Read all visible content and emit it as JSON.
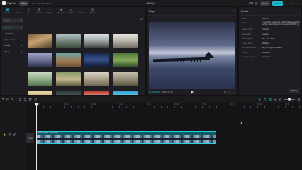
{
  "titlebar": {
    "app_name": "CapCut",
    "menu_label": "Menu",
    "autosave": "Auto saved: 14:38:33",
    "project_title": "0820 (1)",
    "share_label": "Share",
    "export_label": "Export"
  },
  "tools": [
    {
      "label": "Media",
      "icon": "▦"
    },
    {
      "label": "Audio",
      "icon": "♪"
    },
    {
      "label": "Text",
      "icon": "T"
    },
    {
      "label": "Stickers",
      "icon": "✿"
    },
    {
      "label": "Effects",
      "icon": "✦"
    },
    {
      "label": "Transitions",
      "icon": "⧓"
    },
    {
      "label": "Captions",
      "icon": "▭"
    },
    {
      "label": "Filters",
      "icon": "◐"
    },
    {
      "label": "Adjustment",
      "icon": "⊜"
    }
  ],
  "media_side": {
    "import_label": "Import",
    "items": [
      {
        "label": "Spaces"
      },
      {
        "label": "Favorites"
      },
      {
        "label": "My presets"
      },
      {
        "label": "Library"
      },
      {
        "label": "Effects"
      }
    ]
  },
  "player": {
    "title": "Player",
    "timecode_current": "00:00:00:00",
    "timecode_total": "00:00:18:19",
    "ratio_label": "Ratio"
  },
  "details": {
    "title": "Details",
    "rows": [
      {
        "label": "Name:",
        "value": "0820 (1)"
      },
      {
        "label": "Path:",
        "value": "C:/Users/My computer & Local/AppData/Local/CapCut/User Data/Projects/com.lveditor.draft/0820 (1)"
      },
      {
        "label": "Aspect ratio:",
        "value": "Original"
      },
      {
        "label": "Resolution:",
        "value": "Adapted"
      },
      {
        "label": "Color space:",
        "value": "Rec. 709 SDR"
      },
      {
        "label": "Frame rate:",
        "value": "30.00fps"
      },
      {
        "label": "Imported media:",
        "value": "Stay in original location"
      },
      {
        "label": "Proxy:",
        "value": "Turned off"
      },
      {
        "label": "Arrange layers:",
        "value": "Turned on"
      }
    ],
    "modify_label": "Modify"
  },
  "timeline": {
    "ruler": [
      "00:00",
      "00:05",
      "00:10",
      "00:15",
      "00:20",
      "00:25",
      "00:30",
      "00:35",
      "00:40",
      "00:45"
    ],
    "cover_label": "Cover",
    "clip_name": "0820 (1).mp4",
    "clip_duration": "00:00:18:19"
  },
  "colors": {
    "accent": "#1fc6d6",
    "export": "#1fb8c9",
    "clip": "#0e6d75"
  },
  "icons": [
    "undo-icon",
    "redo-icon",
    "split-icon",
    "delete-icon",
    "play-icon",
    "fullscreen-icon",
    "magnet-icon",
    "link-icon",
    "zoom-in-icon",
    "zoom-out-icon"
  ]
}
